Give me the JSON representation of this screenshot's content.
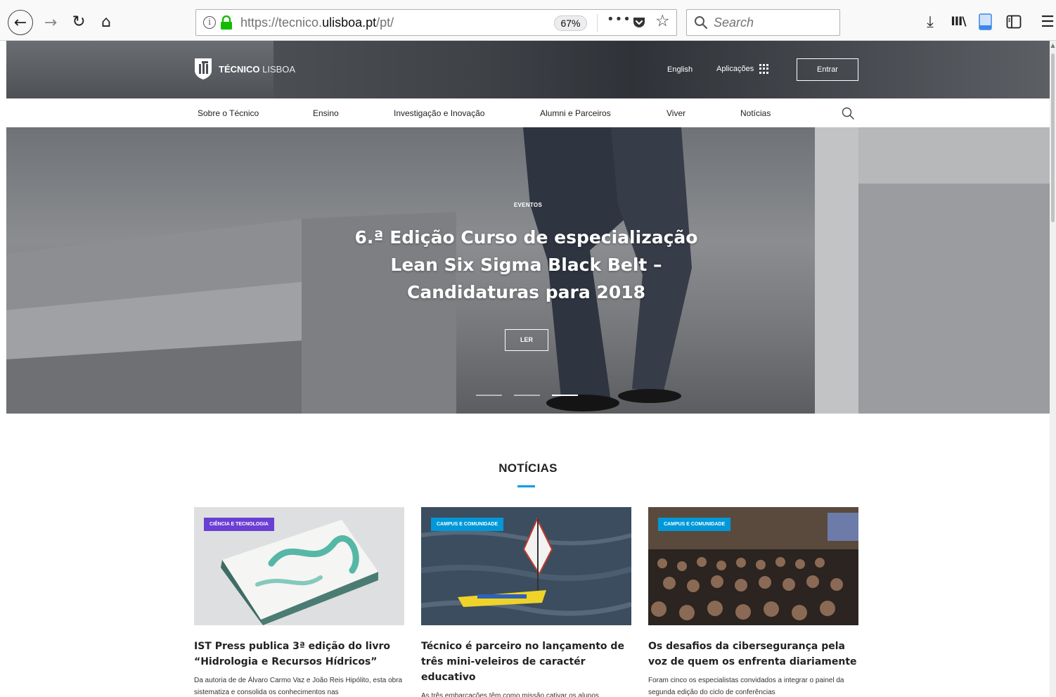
{
  "browser": {
    "url_prefix": "https://tecnico.",
    "url_domain": "ulisboa.pt",
    "url_suffix": "/pt/",
    "zoom": "67%",
    "more_label": "•••",
    "search_placeholder": "Search",
    "icons": [
      "back-icon",
      "forward-icon",
      "reload-icon",
      "home-icon",
      "info-icon",
      "lock-icon",
      "pocket-icon",
      "bookmark-star-icon",
      "search-icon",
      "download-icon",
      "library-icon",
      "reader-icon",
      "sidebar-icon",
      "menu-icon"
    ]
  },
  "site": {
    "logo_bold": "TÉCNICO",
    "logo_light": "LISBOA",
    "lang": "English",
    "apps": "Aplicações",
    "login": "Entrar",
    "nav": [
      "Sobre o Técnico",
      "Ensino",
      "Investigação e Inovação",
      "Alumni e Parceiros",
      "Viver",
      "Notícias"
    ]
  },
  "hero": {
    "category": "EVENTOS",
    "title": "6.ª Edição Curso de especialização Lean Six Sigma Black Belt – Candidaturas para 2018",
    "button": "LER",
    "slides": 3,
    "active_slide": 3
  },
  "news": {
    "section_title": "NOTÍCIAS",
    "accent": "#009de0",
    "items": [
      {
        "badge": "CIÊNCIA E TECNOLOGIA",
        "badge_color": "#6a3fd3",
        "title": "IST Press publica 3ª edição do livro “Hidrologia e Recursos Hídricos”",
        "text": "Da autoria de de Álvaro Carmo Vaz e João Reis Hipólito, esta obra sistematiza e consolida os conhecimentos nas"
      },
      {
        "badge": "CAMPUS E COMUNIDADE",
        "badge_color": "#0098d8",
        "title": "Técnico é parceiro no lançamento de três mini-veleiros de caractér educativo",
        "text": "As três embarcações têm como missão cativar os alunos envolvidos para as temáticas do mar e fazer ligação com"
      },
      {
        "badge": "CAMPUS E COMUNIDADE",
        "badge_color": "#0098d8",
        "title": "Os desafios da cibersegurança pela voz de quem os enfrenta diariamente",
        "text": "Foram cinco os especialistas convidados a integrar o painel da segunda edição do ciclo de conferências"
      }
    ]
  }
}
